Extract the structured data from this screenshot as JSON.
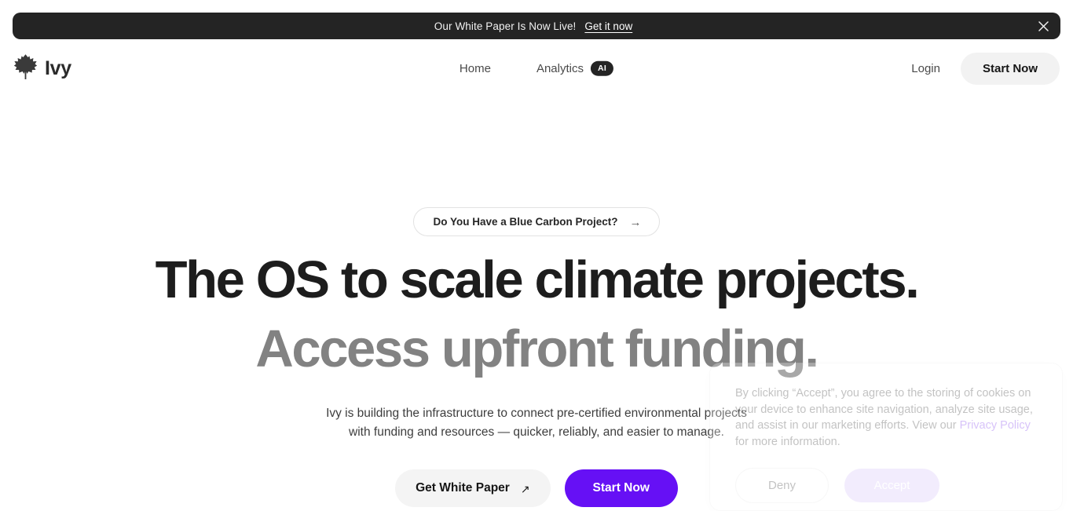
{
  "announcement": {
    "text": "Our White Paper Is Now Live!",
    "link_label": "Get it now",
    "close_icon": "close-icon"
  },
  "header": {
    "brand": {
      "name": "Ivy",
      "icon": "ivy-leaf-logo-icon"
    },
    "nav": [
      {
        "label": "Home"
      },
      {
        "label": "Analytics",
        "badge": "AI"
      }
    ],
    "login_label": "Login",
    "start_now_label": "Start Now"
  },
  "hero": {
    "pill": {
      "label": "Do You Have a Blue Carbon Project?",
      "icon": "arrow-right-icon",
      "glyph": "→"
    },
    "title_line1": "The OS to scale climate projects.",
    "title_line2": "Access upfront funding.",
    "subtitle": "Ivy is building the infrastructure to connect pre-certified environmental projects with funding and resources — quicker, reliably, and easier to manage.",
    "cta_primary_label": "Start Now",
    "cta_secondary_label": "Get White Paper",
    "cta_secondary_icon": "arrow-up-right-icon",
    "cta_secondary_glyph": "↗"
  },
  "cookie_consent": {
    "body_before_link": "By clicking “Accept”, you agree to the storing of cookies on your device to enhance site navigation, analyze site usage, and assist in our marketing efforts. View our ",
    "policy_link_label": "Privacy Policy",
    "body_after_link": " for more information.",
    "deny_label": "Deny",
    "accept_label": "Accept"
  },
  "colors": {
    "accent_purple": "#6610f5",
    "accent_purple_muted": "#d6c2fb",
    "banner_dark": "#242424",
    "heading_primary": "#1d1d1d",
    "heading_secondary": "#828282",
    "link_purple": "#7c3aed",
    "button_neutral": "#f2f2f2"
  }
}
